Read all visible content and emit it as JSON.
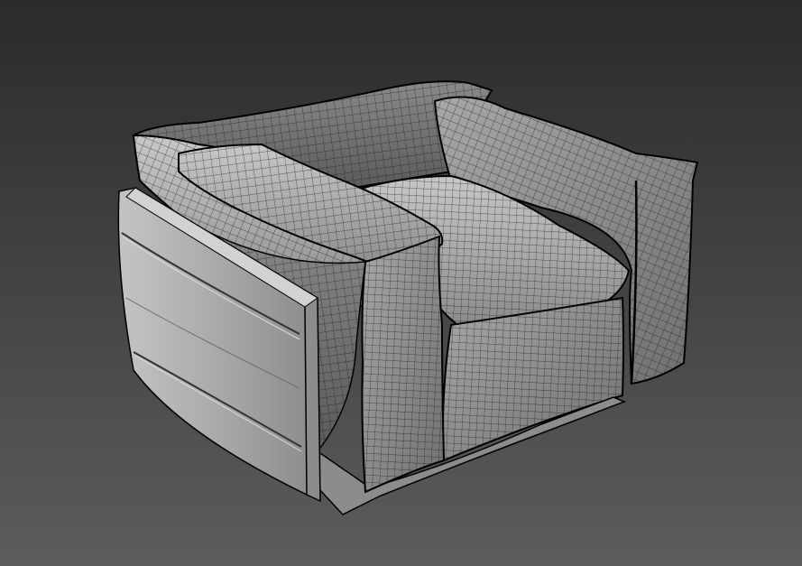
{
  "viewport": {
    "background_top": "#2e2e2e",
    "background_bottom": "#5a5a5a",
    "mesh_fill_light": "#b9b9b9",
    "mesh_fill_mid": "#8e8e8e",
    "mesh_fill_dark": "#5c5c5c",
    "wire_color": "#1a1a1a",
    "edge_color": "#000000"
  },
  "model": {
    "object": "armchair-wireframe"
  }
}
